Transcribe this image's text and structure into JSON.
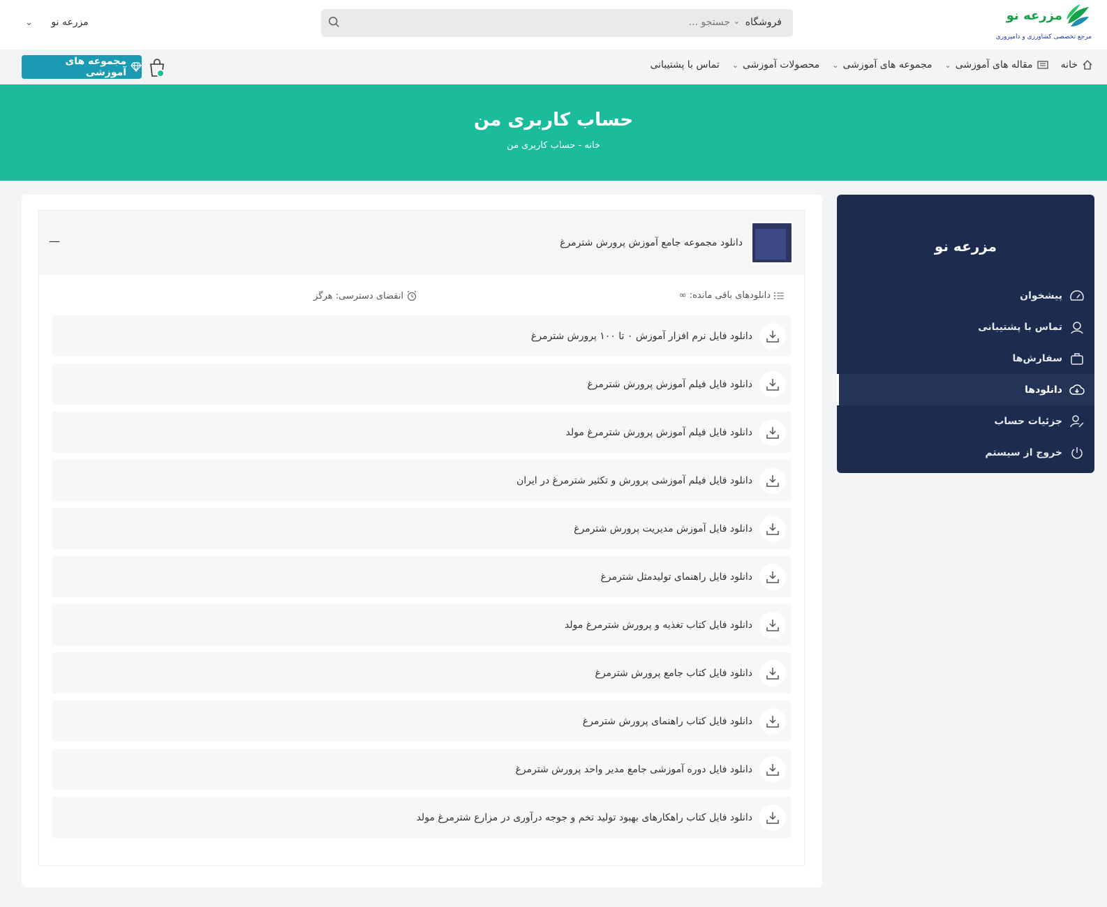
{
  "header": {
    "brand": "مزرعه نو",
    "tagline": "مرجع تخصصی کشاورزی و دامپروری",
    "search_scope": "فروشگاه",
    "search_placeholder": "جستجو ...",
    "account_label": "مزرعه نو"
  },
  "nav": {
    "items": [
      {
        "label": "خانه",
        "icon": "home-icon"
      },
      {
        "label": "مقاله های آموزشی",
        "icon": "newspaper-icon"
      },
      {
        "label": "مجموعه های آموزشی"
      },
      {
        "label": "محصولات آموزشی"
      },
      {
        "label": "تماس با پشتیبانی"
      }
    ],
    "cta_label": "مجموعه های آموزشی",
    "cta_icon": "diamond-icon"
  },
  "hero": {
    "title": "حساب کاربری من",
    "breadcrumb": "خانه - حساب کاربری من"
  },
  "sidebar": {
    "name": "مزرعه نو",
    "items": [
      {
        "label": "پیشخوان",
        "icon": "dashboard-icon"
      },
      {
        "label": "تماس با پشتیبانی",
        "icon": "support-icon"
      },
      {
        "label": "سفارش‌ها",
        "icon": "orders-icon"
      },
      {
        "label": "دانلودها",
        "icon": "cloud-download-icon",
        "active": true
      },
      {
        "label": "جزئیات حساب",
        "icon": "user-edit-icon"
      },
      {
        "label": "خروج از سیستم",
        "icon": "power-icon"
      }
    ]
  },
  "download": {
    "product_title": "دانلود مجموعه جامع آموزش پرورش شترمرغ",
    "collapse_symbol": "—",
    "remaining": "دانلودهای باقی مانده: ∞",
    "expiry": "انقضای دسترسی: هرگز",
    "files": [
      "دانلود فایل نرم افزار آموزش ۰ تا ۱۰۰ پرورش شترمرغ",
      "دانلود فایل فیلم آموزش پرورش شترمرغ",
      "دانلود فایل فیلم آموزش پرورش شترمرغ مولد",
      "دانلود فایل فیلم آموزشی پرورش و تکثیر شترمرغ در ایران",
      "دانلود فایل آموزش مدیریت پرورش شترمرغ",
      "دانلود فایل راهنمای تولیدمثل شترمرغ",
      "دانلود فایل کتاب تغذیه و پرورش شترمرغ مولد",
      "دانلود فایل کتاب جامع پرورش شترمرغ",
      "دانلود فایل کتاب راهنمای پرورش شترمرغ",
      "دانلود فایل دوره آموزشی جامع مدیر واحد پرورش شترمرغ",
      "دانلود فایل کتاب راهکارهای بهبود تولید تخم و جوجه درآوری در مزارع شترمرغ مولد"
    ]
  },
  "colors": {
    "accent": "#1abc9c",
    "sidebar_bg": "#1c2b4e",
    "cta_bg": "#1a9bb3",
    "brand_green": "#16a34a"
  }
}
